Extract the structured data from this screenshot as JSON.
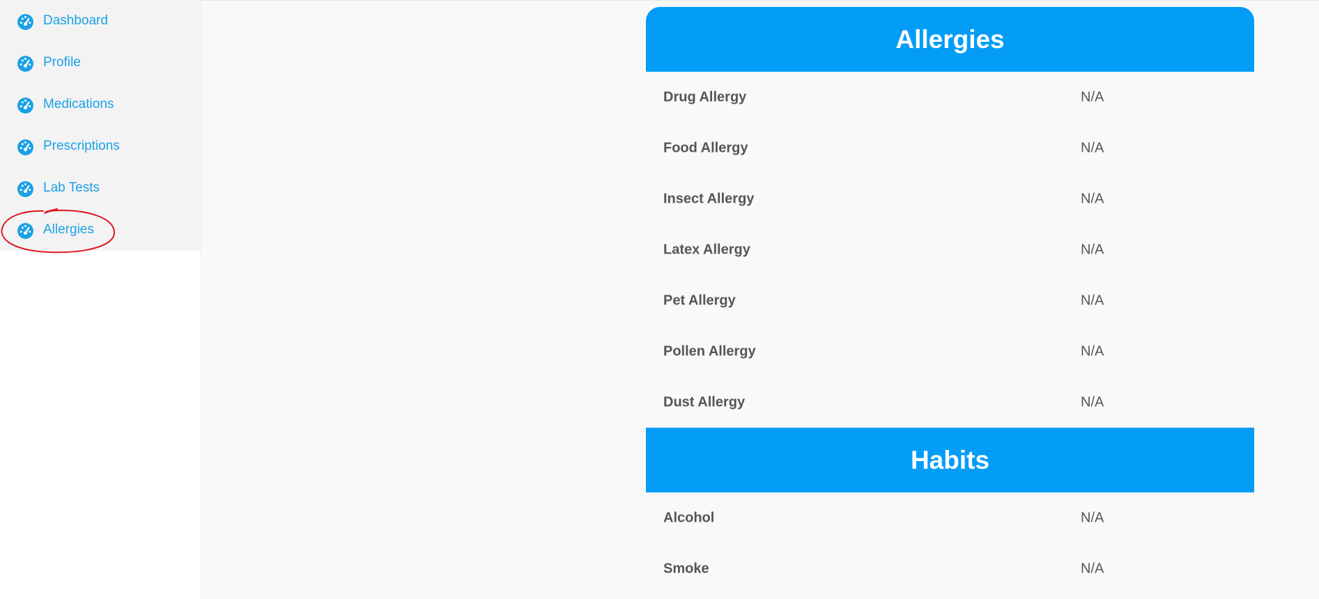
{
  "sidebar": {
    "items": [
      {
        "label": "Dashboard",
        "icon": "dashboard-icon"
      },
      {
        "label": "Profile",
        "icon": "dashboard-icon"
      },
      {
        "label": "Medications",
        "icon": "dashboard-icon"
      },
      {
        "label": "Prescriptions",
        "icon": "dashboard-icon"
      },
      {
        "label": "Lab Tests",
        "icon": "dashboard-icon"
      },
      {
        "label": "Allergies",
        "icon": "dashboard-icon"
      }
    ],
    "highlighted_item": "Allergies"
  },
  "allergies": {
    "title": "Allergies",
    "rows": [
      {
        "label": "Drug Allergy",
        "value": "N/A"
      },
      {
        "label": "Food Allergy",
        "value": "N/A"
      },
      {
        "label": "Insect Allergy",
        "value": "N/A"
      },
      {
        "label": "Latex Allergy",
        "value": "N/A"
      },
      {
        "label": "Pet Allergy",
        "value": "N/A"
      },
      {
        "label": "Pollen Allergy",
        "value": "N/A"
      },
      {
        "label": "Dust Allergy",
        "value": "N/A"
      }
    ]
  },
  "habits": {
    "title": "Habits",
    "rows": [
      {
        "label": "Alcohol",
        "value": "N/A"
      },
      {
        "label": "Smoke",
        "value": "N/A"
      }
    ]
  },
  "colors": {
    "accent": "#039df7",
    "link": "#1aa1e6",
    "annotation": "#e0141e",
    "row_text": "#555555"
  }
}
